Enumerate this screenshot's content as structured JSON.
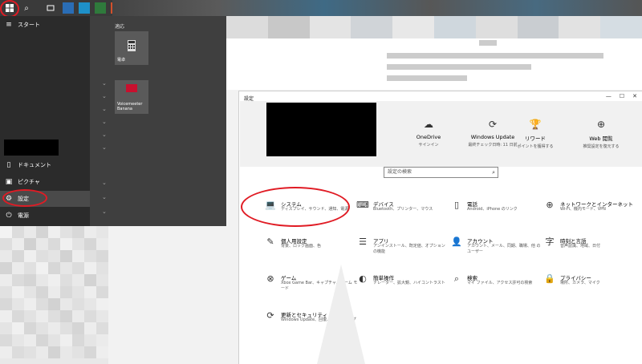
{
  "start_menu": {
    "label": "スタート",
    "group_label": "適応",
    "items": [
      {
        "label": "ドキュメント",
        "icon": "document-icon"
      },
      {
        "label": "ピクチャ",
        "icon": "picture-icon"
      },
      {
        "label": "設定",
        "icon": "gear-icon"
      },
      {
        "label": "電源",
        "icon": "power-icon"
      }
    ],
    "tiles": [
      {
        "label": "電卓",
        "icon": "calculator-icon"
      },
      {
        "label": "Voicemeeter Banana",
        "icon": "voicemeeter-icon"
      }
    ]
  },
  "window": {
    "title": "設定",
    "quick_links": [
      {
        "title": "OneDrive",
        "sub": "サインイン",
        "icon": "onedrive-icon"
      },
      {
        "title": "Windows Update",
        "sub": "最終チェック日時: 11 日前",
        "icon": "update-icon"
      },
      {
        "title": "リワード",
        "sub": "ポイントを獲得する",
        "icon": "rewards-icon"
      },
      {
        "title": "Web 閲覧",
        "sub": "推奨設定を復元する",
        "icon": "globe-icon"
      }
    ],
    "search_placeholder": "設定の検索",
    "categories": [
      {
        "title": "システム",
        "sub": "ディスプレイ、サウンド、通知、電源",
        "icon": "laptop-icon"
      },
      {
        "title": "デバイス",
        "sub": "Bluetooth、プリンター、マウス",
        "icon": "keyboard-icon"
      },
      {
        "title": "電話",
        "sub": "Android、iPhone のリンク",
        "icon": "phone-icon"
      },
      {
        "title": "ネットワークとインターネット",
        "sub": "Wi-Fi、機内モード、VPN",
        "icon": "globe-icon"
      },
      {
        "title": "個人用設定",
        "sub": "背景、ロック画面、色",
        "icon": "brush-icon"
      },
      {
        "title": "アプリ",
        "sub": "アンインストール、既定値、オプション の機能",
        "icon": "apps-icon"
      },
      {
        "title": "アカウント",
        "sub": "アカウント、メール、同期、職場、他 のユーザー",
        "icon": "person-icon"
      },
      {
        "title": "時刻と言語",
        "sub": "音声認識、地域、日付",
        "icon": "time-language-icon"
      },
      {
        "title": "ゲーム",
        "sub": "Xbox Game Bar、キャプチャ、ゲーム モード",
        "icon": "xbox-icon"
      },
      {
        "title": "簡単操作",
        "sub": "ナレーター、拡大鏡、ハイコントラスト",
        "icon": "ease-of-access-icon"
      },
      {
        "title": "検索",
        "sub": "マイ ファイル、アクセス許可の検索",
        "icon": "search-icon"
      },
      {
        "title": "プライバシー",
        "sub": "場所、カメラ、マイク",
        "icon": "lock-icon"
      },
      {
        "title": "更新とセキュリティ",
        "sub": "Windows Update、回復、バック アップ",
        "icon": "update-icon"
      }
    ]
  }
}
